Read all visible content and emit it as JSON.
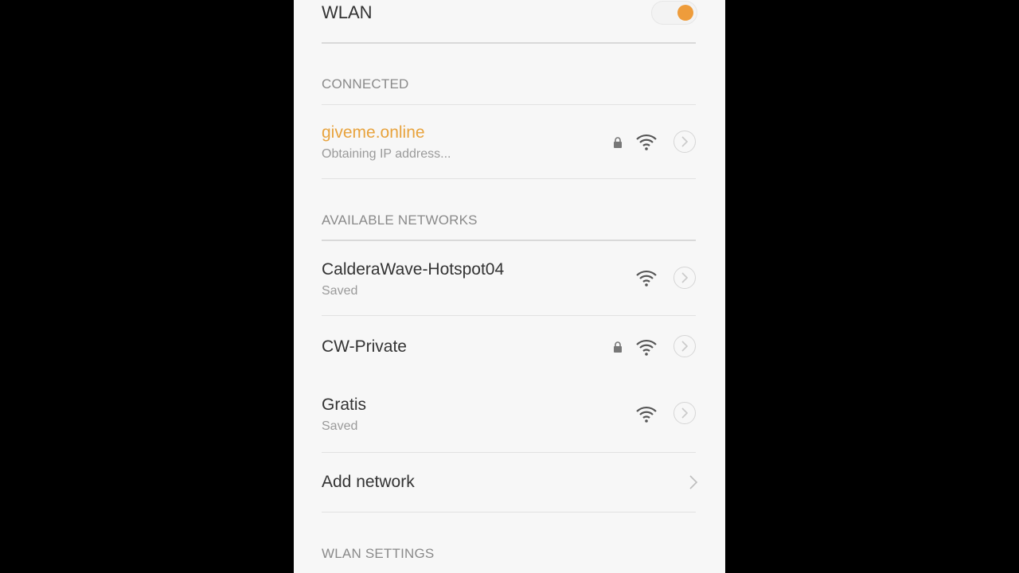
{
  "wlan": {
    "label": "WLAN",
    "enabled": true,
    "toggle_color": "#ee9c3b"
  },
  "connected": {
    "section_label": "CONNECTED",
    "network": {
      "name": "giveme.online",
      "status": "Obtaining IP address...",
      "secured": true,
      "icon": "wifi-icon",
      "name_color": "#e8a33d"
    }
  },
  "available": {
    "section_label": "AVAILABLE NETWORKS",
    "networks": [
      {
        "name": "CalderaWave-Hotspot04",
        "status": "Saved",
        "secured": false
      },
      {
        "name": "CW-Private",
        "status": "",
        "secured": true
      },
      {
        "name": "Gratis",
        "status": "Saved",
        "secured": false
      }
    ]
  },
  "add_network": {
    "label": "Add network"
  },
  "settings": {
    "section_label": "WLAN SETTINGS"
  }
}
